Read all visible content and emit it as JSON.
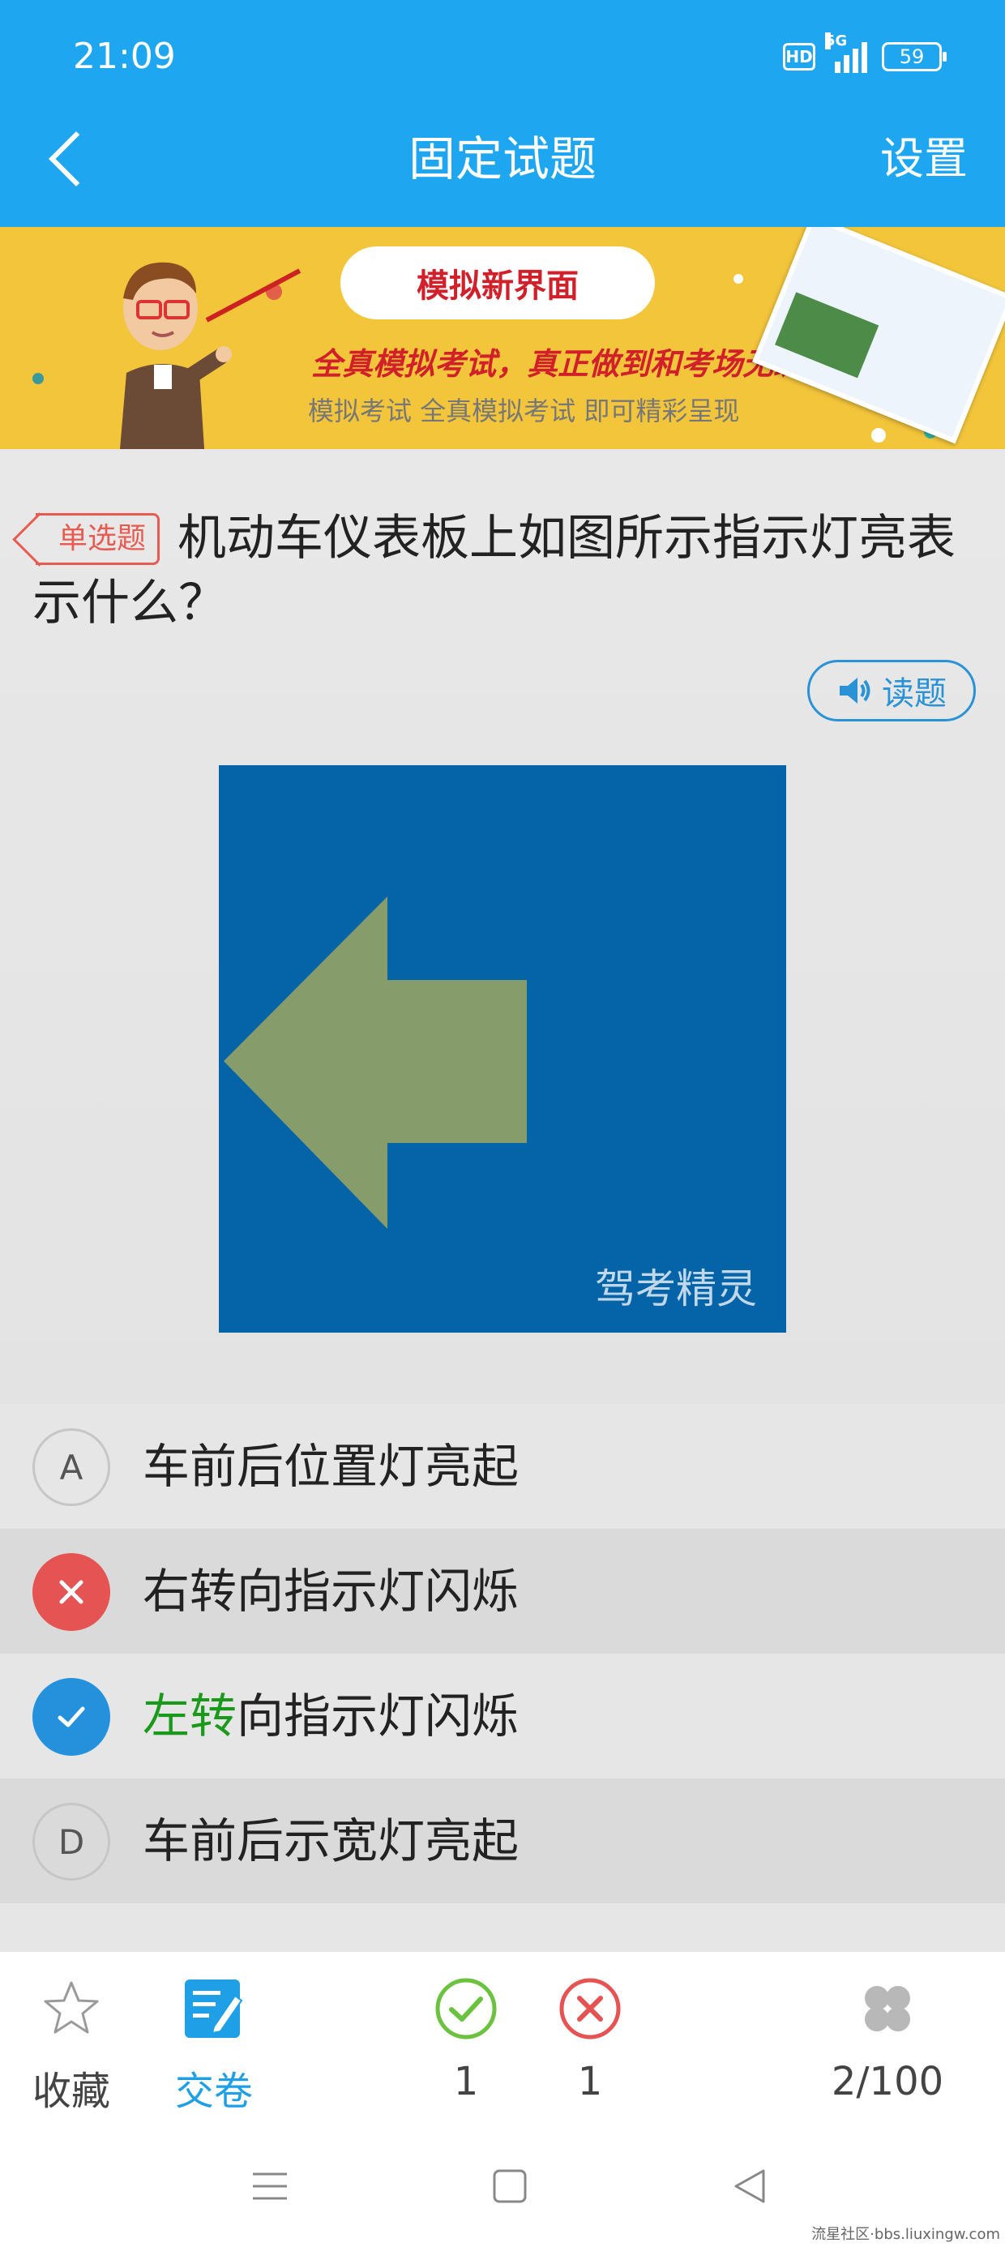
{
  "status_bar": {
    "time": "21:09",
    "hd_label": "HD",
    "network": "5G",
    "battery": "59"
  },
  "nav": {
    "title": "固定试题",
    "settings_label": "设置"
  },
  "banner": {
    "heading": "模拟新界面",
    "tagline": "全真模拟考试，真正做到和考场无缝对接。",
    "subline": "模拟考试 全真模拟考试 即可精彩呈现"
  },
  "question": {
    "type_tag": "单选题",
    "text": "机动车仪表板上如图所示指示灯亮表示什么？",
    "read_button": "读题",
    "image_watermark": "驾考精灵"
  },
  "options": [
    {
      "letter": "A",
      "text": "车前后位置灯亮起",
      "state": "normal"
    },
    {
      "letter": "B",
      "text": "右转向指示灯闪烁",
      "state": "wrong"
    },
    {
      "letter": "C",
      "text_highlight": "左转",
      "text_rest": "向指示灯闪烁",
      "state": "correct"
    },
    {
      "letter": "D",
      "text": "车前后示宽灯亮起",
      "state": "normal"
    }
  ],
  "toolbar": {
    "favorite_label": "收藏",
    "submit_label": "交卷",
    "correct_count": "1",
    "wrong_count": "1",
    "progress": "2/100"
  },
  "footer_credit": "流星社区·bbs.liuxingw.com",
  "colors": {
    "primary": "#1ea7f0",
    "wrong": "#e55353",
    "correct_mark": "#2591dd",
    "correct_text": "#1a9a1a",
    "tag_red": "#e85b50",
    "image_bg": "#0563a8",
    "arrow": "#869c6b"
  }
}
